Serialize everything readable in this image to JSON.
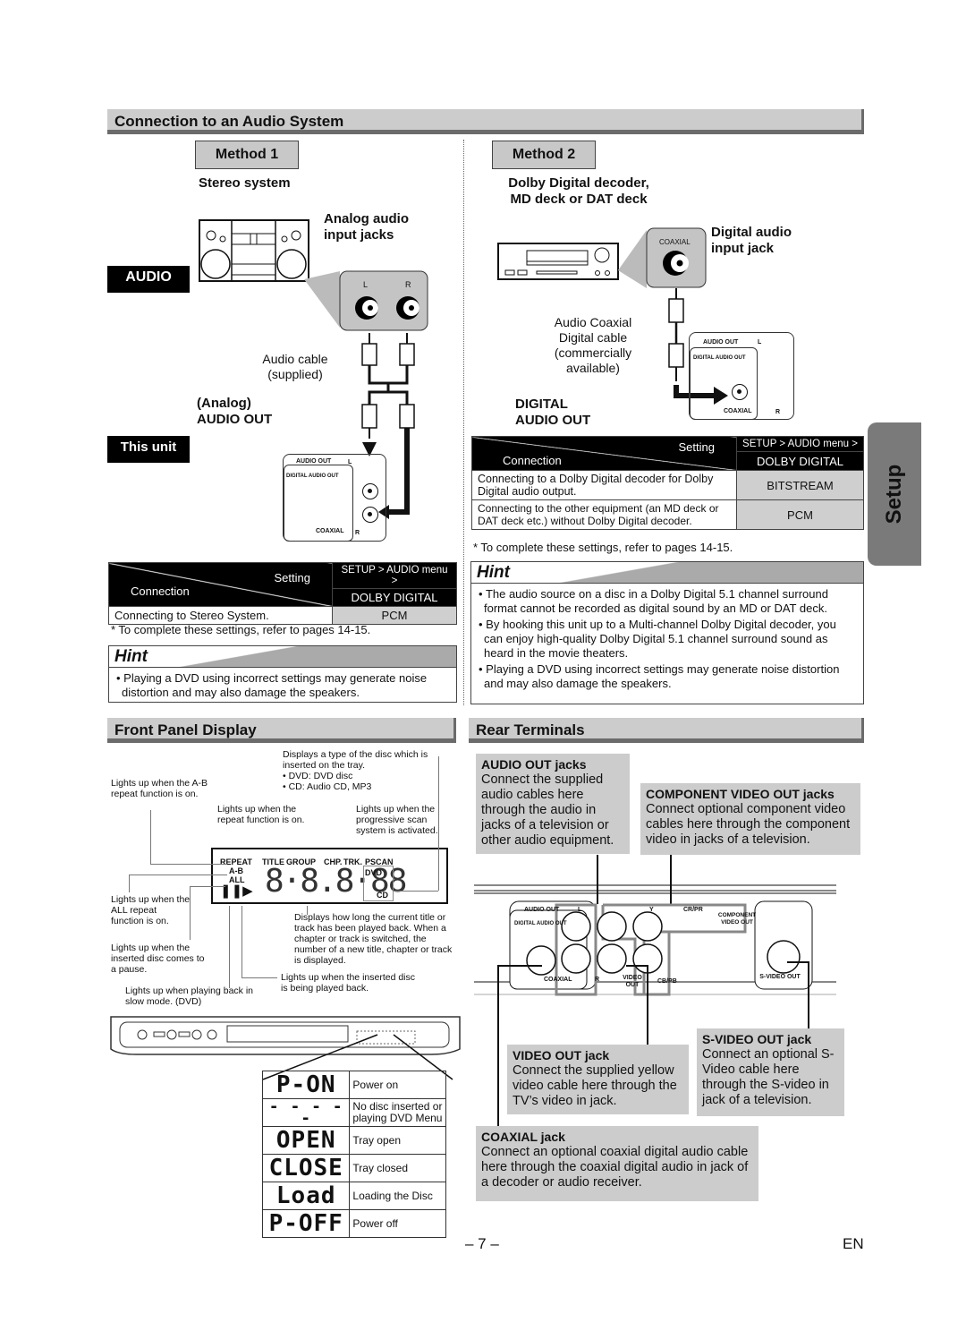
{
  "section_audio": {
    "title": "Connection to an Audio System",
    "method1": {
      "label": "Method 1",
      "device": "Stereo system",
      "input_label": "Analog audio input jacks",
      "input_label_line1": "Analog audio",
      "input_label_line2": "input jacks",
      "audio_tag": "AUDIO",
      "jack_l": "L",
      "jack_r": "R",
      "cable_line1": "Audio cable",
      "cable_line2": "(supplied)",
      "out_line1": "(Analog)",
      "out_line2": "AUDIO OUT",
      "unit_tag": "This unit",
      "panel_audio_out": "AUDIO OUT",
      "panel_l": "L",
      "panel_digital": "DIGITAL AUDIO OUT",
      "panel_coaxial": "COAXIAL",
      "panel_r": "R",
      "table": {
        "setting_header": "Setting",
        "connection_header": "Connection",
        "menu_path": "SETUP > AUDIO menu >",
        "menu_item": "DOLBY DIGITAL",
        "rows": [
          {
            "connection": "Connecting to Stereo System.",
            "value": "PCM"
          }
        ]
      },
      "note": "* To complete these settings, refer to pages 14-15.",
      "hint_title": "Hint",
      "hints": [
        "Playing a DVD using incorrect settings may generate noise distortion and may also damage the speakers."
      ]
    },
    "method2": {
      "label": "Method 2",
      "device_line1": "Dolby Digital decoder,",
      "device_line2": "MD deck or DAT deck",
      "coaxial_label": "COAXIAL",
      "input_line1": "Digital audio",
      "input_line2": "input jack",
      "cable_lines": [
        "Audio Coaxial",
        "Digital cable",
        "(commercially",
        "available)"
      ],
      "out_line1": "DIGITAL",
      "out_line2": "AUDIO OUT",
      "panel_audio_out": "AUDIO OUT",
      "panel_l": "L",
      "panel_digital": "DIGITAL AUDIO OUT",
      "panel_coaxial": "COAXIAL",
      "panel_r": "R",
      "table": {
        "setting_header": "Setting",
        "connection_header": "Connection",
        "menu_path": "SETUP > AUDIO menu >",
        "menu_item": "DOLBY DIGITAL",
        "rows": [
          {
            "connection": "Connecting to a Dolby Digital decoder for Dolby Digital audio output.",
            "value": "BITSTREAM"
          },
          {
            "connection": "Connecting to the other equipment (an MD deck or DAT deck etc.) without Dolby Digital decoder.",
            "value": "PCM"
          }
        ]
      },
      "note": "* To complete these settings, refer to pages 14-15.",
      "hint_title": "Hint",
      "hints": [
        "The audio source on a disc in a Dolby Digital 5.1 channel surround format cannot be recorded as digital sound by an MD or DAT deck.",
        "By hooking this unit up to a Multi-channel Dolby Digital decoder, you can enjoy high-quality Dolby Digital 5.1 channel surround sound as heard in the movie theaters.",
        "Playing a DVD using incorrect settings may generate noise distortion and may also damage the speakers."
      ]
    }
  },
  "setup_tab": "Setup",
  "front_panel": {
    "title": "Front Panel Display",
    "callouts": {
      "disc_type": "Displays a type of the disc which is inserted on the tray.",
      "disc_dvd": "• DVD: DVD disc",
      "disc_cd": "• CD: Audio CD, MP3",
      "ab_repeat": "Lights up when the A-B repeat function is on.",
      "repeat": "Lights up when the repeat function is on.",
      "pscan": "Lights up when the progressive scan system is activated.",
      "all_repeat": "Lights up when the ALL repeat function is on.",
      "pause": "Lights up when the inserted disc comes to a pause.",
      "slow": "Lights up when playing back in slow mode. (DVD)",
      "play": "Lights up when the inserted disc is being played back.",
      "time": "Displays how long the current title or track has been played back. When a chapter or track is switched, the number of a new title, chapter or track is displayed."
    },
    "lcd": {
      "repeat": "REPEAT",
      "ab": "A-B",
      "all": "ALL",
      "title": "TITLE",
      "group": "GROUP",
      "chp": "CHP.",
      "trk": "TRK.",
      "pscan": "PSCAN",
      "dvd": "DVD",
      "cd": "CD",
      "digits": "8·8.8·88",
      "pause_play": "❚❚▶"
    },
    "states": [
      {
        "display": "P-ON",
        "meaning": "Power on"
      },
      {
        "display": "- - - - -",
        "meaning": "No disc inserted or playing DVD Menu"
      },
      {
        "display": "OPEN",
        "meaning": "Tray open"
      },
      {
        "display": "CLOSE",
        "meaning": "Tray closed"
      },
      {
        "display": "Load",
        "meaning": "Loading the Disc"
      },
      {
        "display": "P-OFF",
        "meaning": "Power off"
      }
    ]
  },
  "rear_terminals": {
    "title": "Rear Terminals",
    "panel_labels": {
      "audio_out": "AUDIO OUT",
      "digital_audio_out": "DIGITAL AUDIO OUT",
      "coaxial": "COAXIAL",
      "l": "L",
      "r": "R",
      "y": "Y",
      "cr_pr": "CR/PR",
      "cb_pb": "CB/PB",
      "component": "COMPONENT VIDEO OUT",
      "video_out": "VIDEO OUT",
      "s_video_out": "S-VIDEO OUT"
    },
    "boxes": {
      "audio_out": {
        "title": "AUDIO OUT jacks",
        "text": "Connect the supplied audio cables here through the audio in jacks of a television or other audio equipment."
      },
      "component": {
        "title": "COMPONENT VIDEO OUT jacks",
        "text": "Connect optional component video cables here through the component video in jacks of a television."
      },
      "video_out": {
        "title": "VIDEO OUT jack",
        "text": "Connect the supplied yellow video cable here through the TV’s video in jack."
      },
      "s_video": {
        "title": "S-VIDEO OUT jack",
        "text": "Connect an optional S-Video cable here through the S-video in jack of a television."
      },
      "coaxial": {
        "title": "COAXIAL jack",
        "text": "Connect an optional coaxial digital audio cable here through the coaxial digital audio in jack of a decoder or audio receiver."
      }
    }
  },
  "footer": {
    "page_number": "– 7 –",
    "language": "EN"
  }
}
